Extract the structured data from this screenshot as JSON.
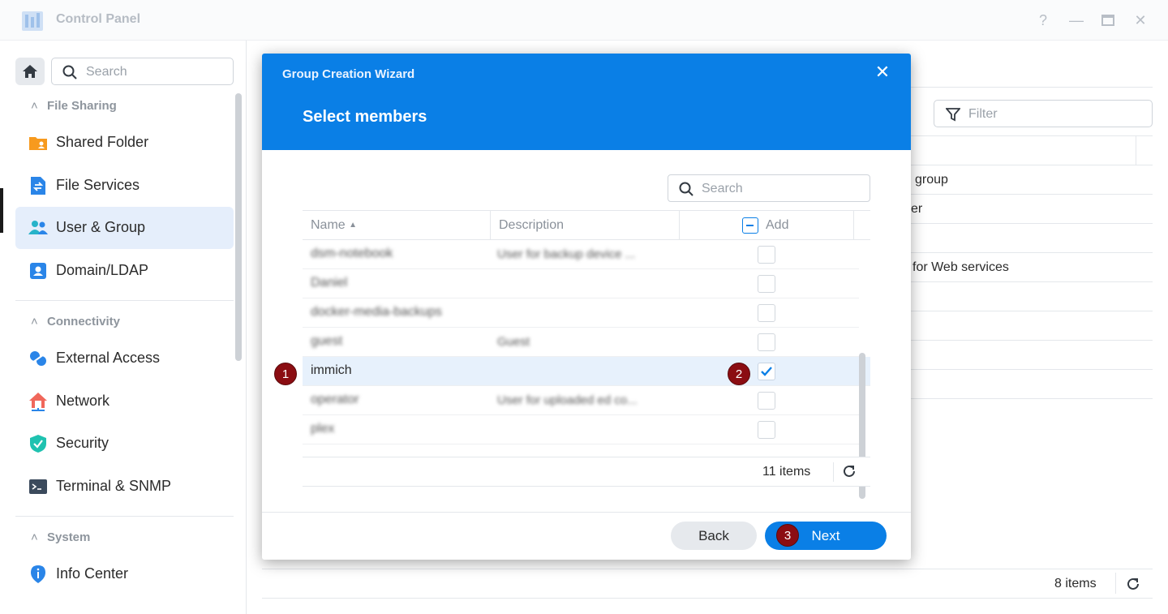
{
  "window": {
    "title": "Control Panel"
  },
  "sidebar": {
    "search_placeholder": "Search",
    "sections": [
      {
        "label": "File Sharing"
      },
      {
        "label": "Connectivity"
      },
      {
        "label": "System"
      }
    ],
    "items": [
      {
        "label": "Shared Folder",
        "icon": "shared-folder-icon"
      },
      {
        "label": "File Services",
        "icon": "file-services-icon"
      },
      {
        "label": "User & Group",
        "icon": "user-group-icon",
        "active": true
      },
      {
        "label": "Domain/LDAP",
        "icon": "domain-ldap-icon"
      },
      {
        "label": "External Access",
        "icon": "external-access-icon"
      },
      {
        "label": "Network",
        "icon": "network-icon"
      },
      {
        "label": "Security",
        "icon": "security-shield-icon"
      },
      {
        "label": "Terminal & SNMP",
        "icon": "terminal-icon"
      },
      {
        "label": "Info Center",
        "icon": "info-center-icon"
      }
    ]
  },
  "background": {
    "filter_placeholder": "Filter",
    "cells": [
      "group",
      "er",
      "for Web services"
    ],
    "footer_count": "8 items"
  },
  "dialog": {
    "title": "Group Creation Wizard",
    "step_title": "Select members",
    "search_placeholder": "Search",
    "columns": {
      "name": "Name",
      "description": "Description",
      "add": "Add"
    },
    "rows": [
      {
        "name": "dsm-notebook",
        "description": "User for backup device ...",
        "checked": false,
        "blurred": true
      },
      {
        "name": "Daniel",
        "description": "",
        "checked": false,
        "blurred": true
      },
      {
        "name": "docker-media-backups",
        "description": "",
        "checked": false,
        "blurred": true
      },
      {
        "name": "guest",
        "description": "Guest",
        "checked": false,
        "blurred": true
      },
      {
        "name": "immich",
        "description": "",
        "checked": true,
        "blurred": false
      },
      {
        "name": "operator",
        "description": "User for uploaded ed co...",
        "checked": false,
        "blurred": true
      },
      {
        "name": "plex",
        "description": "",
        "checked": false,
        "blurred": true
      }
    ],
    "footer_count": "11 items",
    "buttons": {
      "back": "Back",
      "next": "Next"
    }
  },
  "annotations": [
    "1",
    "2",
    "3"
  ]
}
